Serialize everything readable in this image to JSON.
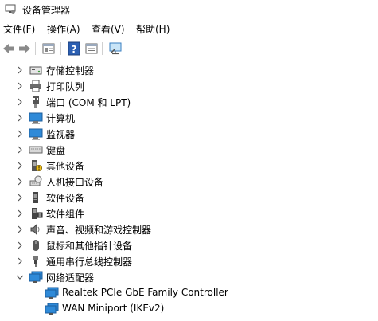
{
  "window": {
    "title": "设备管理器"
  },
  "menu": [
    {
      "label": "文件(F)"
    },
    {
      "label": "操作(A)"
    },
    {
      "label": "查看(V)"
    },
    {
      "label": "帮助(H)"
    }
  ],
  "toolbar": {
    "buttons": [
      "back-arrow-icon",
      "forward-arrow-icon",
      "properties-icon",
      "help-icon",
      "update-driver-icon",
      "monitor-scan-icon"
    ]
  },
  "tree": {
    "categories": [
      {
        "label": "存储控制器",
        "icon": "storage-controller-icon",
        "expanded": false
      },
      {
        "label": "打印队列",
        "icon": "printer-icon",
        "expanded": false
      },
      {
        "label": "端口 (COM 和 LPT)",
        "icon": "port-icon",
        "expanded": false
      },
      {
        "label": "计算机",
        "icon": "computer-icon",
        "expanded": false
      },
      {
        "label": "监视器",
        "icon": "monitor-icon",
        "expanded": false
      },
      {
        "label": "键盘",
        "icon": "keyboard-icon",
        "expanded": false
      },
      {
        "label": "其他设备",
        "icon": "other-devices-icon",
        "expanded": false
      },
      {
        "label": "人机接口设备",
        "icon": "hid-icon",
        "expanded": false
      },
      {
        "label": "软件设备",
        "icon": "software-device-icon",
        "expanded": false
      },
      {
        "label": "软件组件",
        "icon": "software-component-icon",
        "expanded": false
      },
      {
        "label": "声音、视频和游戏控制器",
        "icon": "speaker-icon",
        "expanded": false
      },
      {
        "label": "鼠标和其他指针设备",
        "icon": "mouse-icon",
        "expanded": false
      },
      {
        "label": "通用串行总线控制器",
        "icon": "usb-icon",
        "expanded": false
      },
      {
        "label": "网络适配器",
        "icon": "network-adapter-icon",
        "expanded": true
      }
    ],
    "network_children": [
      {
        "label": "Realtek PCIe GbE Family Controller",
        "icon": "network-adapter-icon"
      },
      {
        "label": "WAN Miniport (IKEv2)",
        "icon": "network-adapter-icon"
      }
    ]
  },
  "colors": {
    "monitor_blue": "#2f8ad8",
    "chevron": "#555555"
  }
}
